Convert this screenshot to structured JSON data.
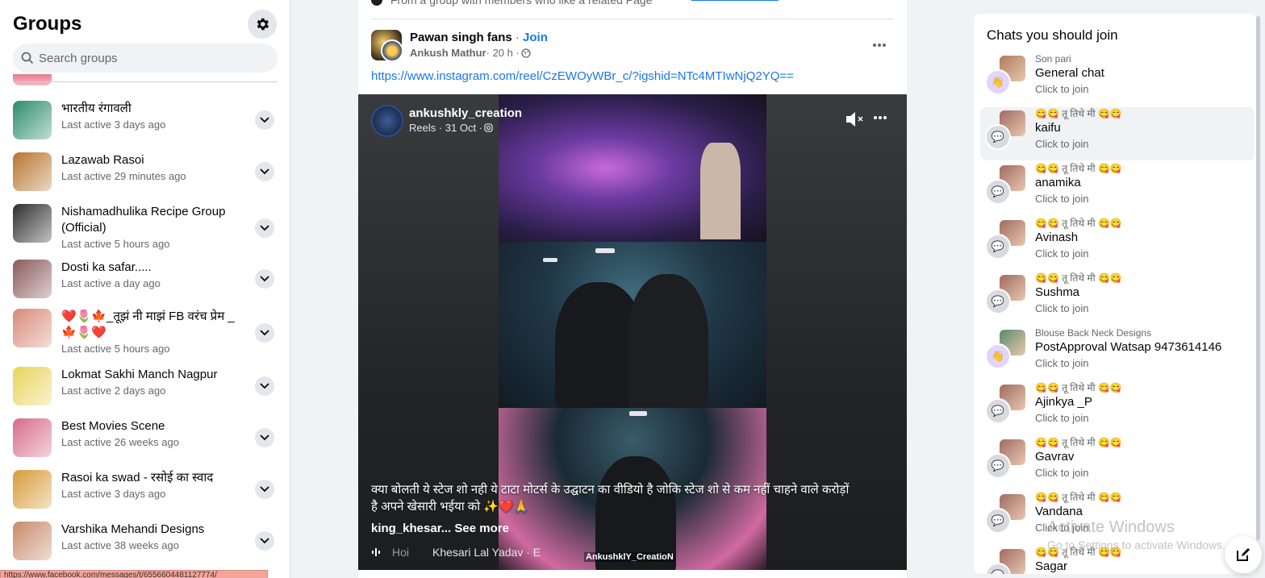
{
  "sidebar": {
    "title": "Groups",
    "search_placeholder": "Search groups",
    "groups": [
      {
        "name": "भारतीय रंगावली",
        "meta": "Last active 3 days ago",
        "color": "#2a8c6a"
      },
      {
        "name": "Lazawab Rasoi",
        "meta": "Last active 29 minutes ago",
        "color": "#b8742e"
      },
      {
        "name": "Nishamadhulika Recipe Group (Official)",
        "meta": "Last active 5 hours ago",
        "color": "#2d2d2d"
      },
      {
        "name": "Dosti ka safar.....",
        "meta": "Last active a day ago",
        "color": "#8a5a5a"
      },
      {
        "name": "❤️🌷🍁_तूझं नी माझं FB वरंच प्रेम _🍁🌷❤️",
        "meta": "Last active 5 hours ago",
        "color": "#d88a78"
      },
      {
        "name": "Lokmat Sakhi Manch Nagpur",
        "meta": "Last active 2 days ago",
        "color": "#e9d45a"
      },
      {
        "name": "Best Movies Scene",
        "meta": "Last active 26 weeks ago",
        "color": "#d76a8a"
      },
      {
        "name": "Rasoi ka swad - रसोई का स्वाद",
        "meta": "Last active 3 days ago",
        "color": "#d89a3a"
      },
      {
        "name": "Varshika Mehandi Designs",
        "meta": "Last active 38 weeks ago",
        "color": "#c78a6a"
      }
    ],
    "status_url": "https://www.facebook.com/messages/t/6556604481127774/"
  },
  "feed": {
    "top_strip": "From a group with members who like a related Page",
    "post": {
      "group": "Pawan singh fans",
      "separator": " · ",
      "join": "Join",
      "author": "Ankush Mathur",
      "time": " · 20 h · ",
      "link": "https://www.instagram.com/reel/CzEWOyWBr_c/?igshid=NTc4MTIwNjQ2YQ=="
    },
    "video": {
      "creator": "ankushkly_creation",
      "meta": "Reels · 31 Oct · ",
      "caption": "क्या बोलती ये स्टेज शो नही ये टाटा मोटर्स के उद्घाटन का वीडियो है जोकि स्टेज शो से कम नहीं चाहने वाले करोड़ों है अपने खेसारी भईया को ✨❤️🙏",
      "tag": "king_khesar... See more",
      "music_prev": "Hoi",
      "music": "Khesari Lal Yadav · E",
      "watermark": "AnkushklY_CreatioN"
    }
  },
  "right": {
    "title": "Chats you should join",
    "chats": [
      {
        "sub": "Son pari",
        "name": "General chat",
        "action": "Click to join",
        "badge": "wave",
        "img": "#b07a5a"
      },
      {
        "sub": "😋😋 तू तिथे मी 😋😋",
        "name": "kaifu",
        "action": "Click to join",
        "badge": "bubble",
        "img": "#a06a60"
      },
      {
        "sub": "😋😋 तू तिथे मी 😋😋",
        "name": "anamika",
        "action": "Click to join",
        "badge": "bubble",
        "img": "#a06a60"
      },
      {
        "sub": "😋😋 तू तिथे मी 😋😋",
        "name": "Avinash",
        "action": "Click to join",
        "badge": "bubble",
        "img": "#a06a60"
      },
      {
        "sub": "😋😋 तू तिथे मी 😋😋",
        "name": "Sushma",
        "action": "Click to join",
        "badge": "bubble",
        "img": "#a06a60"
      },
      {
        "sub": "Blouse Back Neck Designs",
        "name": "PostApproval Watsap 9473614146",
        "action": "Click to join",
        "badge": "wave",
        "img": "#5a8a6a"
      },
      {
        "sub": "😋😋 तू तिथे मी 😋😋",
        "name": "Ajinkya _P",
        "action": "Click to join",
        "badge": "bubble",
        "img": "#a06a60"
      },
      {
        "sub": "😋😋 तू तिथे मी 😋😋",
        "name": "Gavrav",
        "action": "Click to join",
        "badge": "bubble",
        "img": "#a06a60"
      },
      {
        "sub": "😋😋 तू तिथे मी 😋😋",
        "name": "Vandana",
        "action": "Click to join",
        "badge": "bubble",
        "img": "#a06a60"
      },
      {
        "sub": "😋😋 तू तिथे मी 😋😋",
        "name": "Sagar",
        "action": "",
        "badge": "bubble",
        "img": "#a06a60"
      }
    ],
    "os_watermark": "Activate Windows",
    "os_watermark_sub": "Go to Settings to activate Windows."
  }
}
